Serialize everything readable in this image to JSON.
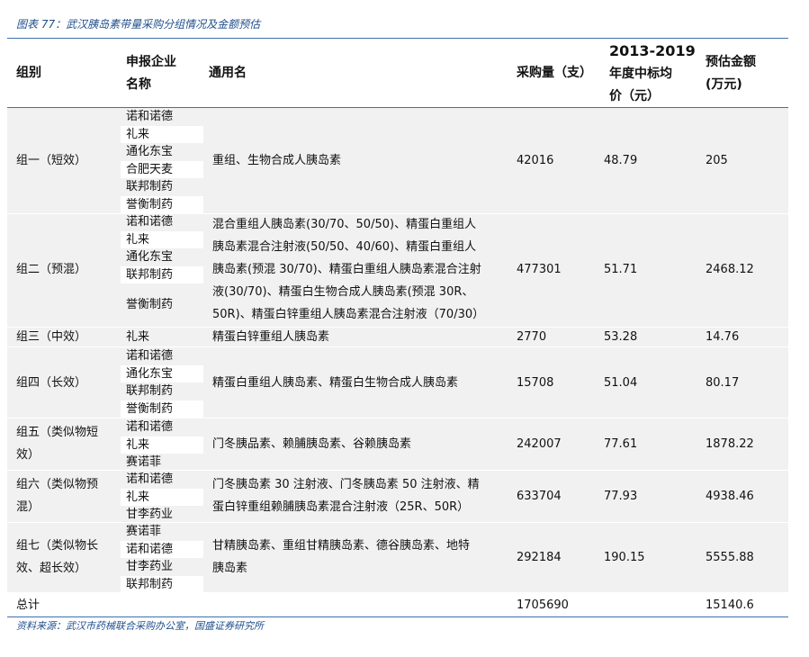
{
  "caption": "图表 77：武汉胰岛素带量采购分组情况及金额预估",
  "headers": {
    "group": "组别",
    "company_1": "申报企业",
    "company_2": "名称",
    "generic": "通用名",
    "quantity": "采购量（支）",
    "price_1": "2013-2019",
    "price_2": "年度中标均",
    "price_3": "价（元）",
    "amount_1": "预估金额",
    "amount_2": "(万元)"
  },
  "rows": [
    {
      "group": [
        "组一（短效）"
      ],
      "companies": [
        "诺和诺德",
        "礼来",
        "通化东宝",
        "合肥天麦",
        "联邦制药",
        "誉衡制药"
      ],
      "generic": [
        "重组、生物合成人胰岛素"
      ],
      "quantity": "42016",
      "price": "48.79",
      "amount": "205"
    },
    {
      "group": [
        "组二（预混）"
      ],
      "companies": [
        "诺和诺德",
        "礼来",
        "通化东宝",
        "联邦制药",
        "誉衡制药"
      ],
      "generic": [
        "混合重组人胰岛素(30/70、50/50)、精蛋白重组人",
        "胰岛素混合注射液(50/50、40/60)、精蛋白重组人",
        "胰岛素(预混 30/70)、精蛋白重组人胰岛素混合注射",
        "液(30/70)、精蛋白生物合成人胰岛素(预混 30R、",
        "50R)、精蛋白锌重组人胰岛素混合注射液（70/30）"
      ],
      "quantity": "477301",
      "price": "51.71",
      "amount": "2468.12"
    },
    {
      "group": [
        "组三（中效）"
      ],
      "companies": [
        "礼来"
      ],
      "generic": [
        "精蛋白锌重组人胰岛素"
      ],
      "quantity": "2770",
      "price": "53.28",
      "amount": "14.76"
    },
    {
      "group": [
        "组四（长效）"
      ],
      "companies": [
        "诺和诺德",
        "通化东宝",
        "联邦制药",
        "誉衡制药"
      ],
      "generic": [
        "精蛋白重组人胰岛素、精蛋白生物合成人胰岛素"
      ],
      "quantity": "15708",
      "price": "51.04",
      "amount": "80.17"
    },
    {
      "group": [
        "组五（类似物短",
        "效）"
      ],
      "companies": [
        "诺和诺德",
        "礼来",
        "赛诺菲"
      ],
      "generic": [
        "门冬胰品素、赖脯胰岛素、谷赖胰岛素"
      ],
      "quantity": "242007",
      "price": "77.61",
      "amount": "1878.22"
    },
    {
      "group": [
        "组六（类似物预",
        "混）"
      ],
      "companies": [
        "诺和诺德",
        "礼来",
        "甘李药业"
      ],
      "generic": [
        "门冬胰岛素 30 注射液、门冬胰岛素 50 注射液、精",
        "蛋白锌重组赖脯胰岛素混合注射液（25R、50R）"
      ],
      "quantity": "633704",
      "price": "77.93",
      "amount": "4938.46"
    },
    {
      "group": [
        "组七（类似物长",
        "效、超长效）"
      ],
      "companies": [
        "赛诺菲",
        "诺和诺德",
        "甘李药业",
        "联邦制药"
      ],
      "generic": [
        "甘精胰岛素、重组甘精胰岛素、德谷胰岛素、地特",
        "胰岛素"
      ],
      "quantity": "292184",
      "price": "190.15",
      "amount": "5555.88"
    }
  ],
  "total": {
    "label": "总计",
    "quantity": "1705690",
    "amount": "15140.6"
  },
  "source": "资料来源：武汉市药械联合采购办公室，国盛证券研究所",
  "colors": {
    "rule": "#3f6fb0",
    "row_fill": "#f1f1f1",
    "caption": "#1f4e8c"
  }
}
